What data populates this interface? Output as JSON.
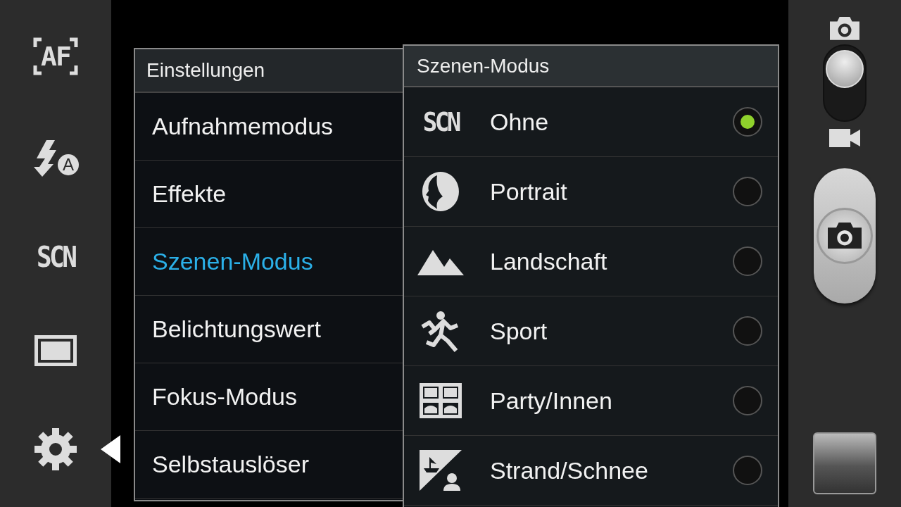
{
  "left_toolbar": [
    {
      "kind": "af",
      "label": "AF",
      "selected": false
    },
    {
      "kind": "flash_auto",
      "label": "A",
      "selected": false
    },
    {
      "kind": "scene",
      "label": "SCN",
      "selected": false
    },
    {
      "kind": "aspect",
      "selected": false
    },
    {
      "kind": "settings",
      "selected": true
    }
  ],
  "settings_menu": {
    "title": "Einstellungen",
    "items": [
      {
        "label": "Aufnahmemodus",
        "selected": false
      },
      {
        "label": "Effekte",
        "selected": false
      },
      {
        "label": "Szenen-Modus",
        "selected": true
      },
      {
        "label": "Belichtungswert",
        "selected": false
      },
      {
        "label": "Fokus-Modus",
        "selected": false
      },
      {
        "label": "Selbstauslöser",
        "selected": false
      }
    ]
  },
  "scene_menu": {
    "title": "Szenen-Modus",
    "options": [
      {
        "kind": "none",
        "icon_label": "SCN",
        "label": "Ohne",
        "selected": true
      },
      {
        "kind": "portrait",
        "label": "Portrait",
        "selected": false
      },
      {
        "kind": "landscape",
        "label": "Landschaft",
        "selected": false
      },
      {
        "kind": "sport",
        "label": "Sport",
        "selected": false
      },
      {
        "kind": "party",
        "label": "Party/Innen",
        "selected": false
      },
      {
        "kind": "beach",
        "label": "Strand/Schnee",
        "selected": false
      }
    ]
  },
  "mode_switch": {
    "video": false
  }
}
